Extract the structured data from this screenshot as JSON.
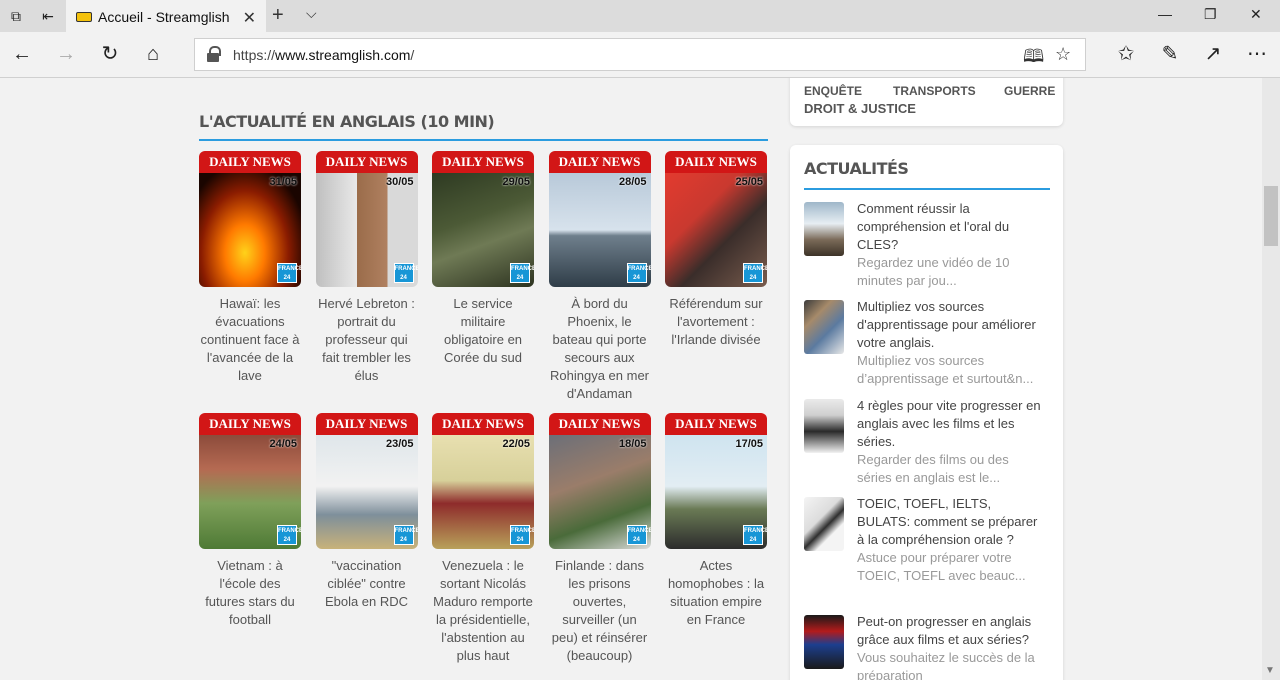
{
  "browser": {
    "tab_title": "Accueil - Streamglish",
    "url_prefix": "https://",
    "url_domain": "www.streamglish.com",
    "url_suffix": "/"
  },
  "section": {
    "title": "L'ACTUALITÉ EN ANGLAIS (10 MIN)",
    "badge_label": "DAILY NEWS",
    "logo_label": "FRANCE 24"
  },
  "videos": [
    {
      "date": "31/05",
      "caption": "Hawaï: les évacuations continuent face à l'avancée de la lave"
    },
    {
      "date": "30/05",
      "caption": "Hervé Lebreton : portrait du professeur qui fait trembler les élus"
    },
    {
      "date": "29/05",
      "caption": "Le service militaire obligatoire en Corée du sud"
    },
    {
      "date": "28/05",
      "caption": "À bord du Phoenix, le bateau qui porte secours aux Rohingya en mer d'Andaman"
    },
    {
      "date": "25/05",
      "caption": "Référendum sur l'avortement : l'Irlande divisée"
    },
    {
      "date": "24/05",
      "caption": "Vietnam : à l'école des futures stars du football"
    },
    {
      "date": "23/05",
      "caption": "\"vaccination ciblée\" contre Ebola en RDC"
    },
    {
      "date": "22/05",
      "caption": "Venezuela : le sortant Nicolás Maduro remporte la présidentielle, l'abstention au plus haut"
    },
    {
      "date": "18/05",
      "caption": "Finlande : dans les prisons ouvertes, surveiller (un peu) et réinsérer (beaucoup)"
    },
    {
      "date": "17/05",
      "caption": "Actes homophobes : la situation empire en France"
    }
  ],
  "tags": [
    "ENQUÊTE",
    "TRANSPORTS",
    "GUERRE",
    "DROIT & JUSTICE"
  ],
  "sidebar": {
    "title": "ACTUALITÉS",
    "items": [
      {
        "title": "Comment réussir la compréhension et l'oral du CLES?",
        "summary": "Regardez une vidéo de 10 minutes par jou..."
      },
      {
        "title": "Multipliez vos sources d'apprentissage pour améliorer votre anglais.",
        "summary": "Multipliez vos sources d’apprentissage et surtout&n..."
      },
      {
        "title": "4 règles pour vite progresser en anglais avec les films et les séries.",
        "summary": "Regarder des films ou des séries en anglais est le..."
      },
      {
        "title": "TOEIC, TOEFL, IELTS, BULATS: comment se préparer à la compréhension orale ?",
        "summary": "Astuce pour préparer votre TOEIC, TOEFL avec beauc..."
      },
      {
        "title": "Peut-on progresser en anglais grâce aux films et aux séries?",
        "summary": "Vous souhaitez le succès de la préparation"
      }
    ]
  },
  "colors": {
    "accent": "#2b9cdf",
    "badge": "#d21616"
  },
  "icons": [
    "tab-actions-icon",
    "back-icon",
    "forward-icon",
    "refresh-icon",
    "home-icon",
    "lock-icon",
    "reading-view-icon",
    "favorite-star-icon",
    "favorites-hub-icon",
    "pen-icon",
    "share-icon",
    "more-icon",
    "france24-logo-icon"
  ]
}
